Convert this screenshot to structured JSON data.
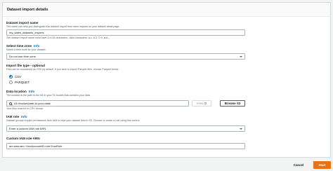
{
  "panel": {
    "title": "Dataset import details"
  },
  "dataset_name": {
    "label": "Dataset import name",
    "description": "The name can help you distinguish this dataset import from other imports on your dataset detail page.",
    "value": "my_sales_datasets_imports",
    "hint": "The dataset import name must have 1 to 63 characters. Valid characters: a-z, A-Z, 0-9, and _"
  },
  "time_zone": {
    "label": "Select time zone",
    "info": "Info",
    "description": "Select a time zone for your dataset.",
    "selected": "Do not use time zone"
  },
  "file_type": {
    "label": "Import file type - optional",
    "description": "Files will be considered as CSV by default. If you wish to import Parquet files, choose Parquet below.",
    "options": [
      "CSV",
      "PARQUET"
    ],
    "selected": "CSV"
  },
  "data_location": {
    "label": "Data location",
    "info": "Info",
    "description": "The location is the path to the file in your S3 bucket that contains your data.",
    "value": "s3://bucket/path-to-your-data/",
    "hint": "Your files must be in CSV format.",
    "view_label": "View",
    "browse_label": "Browse S3"
  },
  "iam_role": {
    "label": "IAM role",
    "info": "Info",
    "description": "Dataset groups require permissions from IAM to read your dataset files in S3. Choose or create a role using this control.",
    "selected": "Enter a custom IAM role ARN"
  },
  "custom_arn": {
    "label": "Custom IAM role ARN",
    "value": "arn:aws:iam::YourAccountID:role/YourRole"
  },
  "footer": {
    "cancel_label": "Cancel",
    "start_label": "Start"
  },
  "colors": {
    "accent": "#ec7211",
    "link": "#0073bb"
  }
}
